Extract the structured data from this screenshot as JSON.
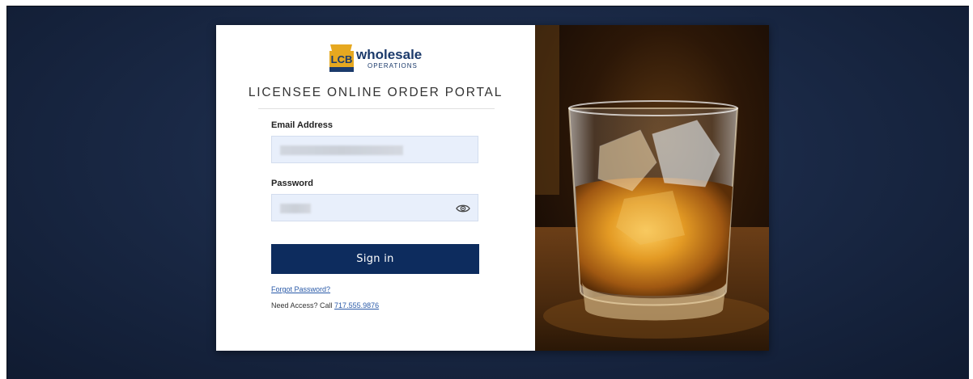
{
  "logo": {
    "mark": "LCB",
    "wordmark": "wholesale",
    "tagline": "OPERATIONS"
  },
  "portal": {
    "title": "LICENSEE ONLINE ORDER PORTAL"
  },
  "form": {
    "email_label": "Email Address",
    "password_label": "Password",
    "signin_label": "Sign in",
    "forgot_label": "Forgot Password?",
    "access_prefix": "Need Access? Call ",
    "phone": "717.555.9876"
  },
  "icons": {
    "password_toggle": "eye-icon"
  },
  "colors": {
    "background": "#1a2946",
    "button": "#0d2c5e",
    "link": "#2a5aa8",
    "logo_gold": "#e6a820",
    "logo_navy": "#1b3a6b",
    "input_fill": "#e8effb"
  }
}
